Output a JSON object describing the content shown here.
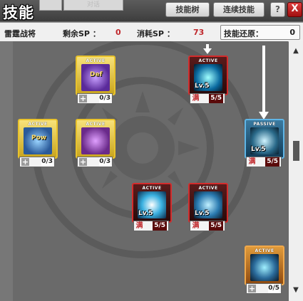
{
  "window": {
    "title": "技能",
    "ghost_tab_1": "",
    "ghost_tab_2": "对话",
    "tab_skill_tree": "技能树",
    "tab_combo_skill": "连续技能",
    "help": "?",
    "close": "X"
  },
  "info": {
    "class_name": "雷霆战将",
    "remaining_sp_label": "剩余SP ：",
    "remaining_sp": "0",
    "consumed_sp_label": "消耗SP ：",
    "consumed_sp": "73",
    "reset_label": "技能还原：",
    "reset_value": "0"
  },
  "colors": {
    "active_yellow": "#e8c22b",
    "active_red": "#d42c2c",
    "passive_blue": "#5fb5e6",
    "active_orange": "#f0a84a",
    "max_red": "#c0282c"
  },
  "skills": [
    {
      "id": "s1",
      "type": "ACTIVE",
      "state": "locked",
      "icon_text": "Def",
      "points": "0/3",
      "level": ""
    },
    {
      "id": "s2",
      "type": "ACTIVE",
      "state": "maxed",
      "icon_text": "",
      "points": "5/5",
      "level": "Lv.5",
      "max_mark": "满"
    },
    {
      "id": "s3",
      "type": "ACTIVE",
      "state": "locked",
      "icon_text": "Pow",
      "points": "0/3",
      "level": ""
    },
    {
      "id": "s4",
      "type": "ACTIVE",
      "state": "locked",
      "icon_text": "",
      "points": "0/3",
      "level": ""
    },
    {
      "id": "s5",
      "type": "PASSIVE",
      "state": "maxed",
      "icon_text": "",
      "points": "5/5",
      "level": "Lv.5",
      "max_mark": "满"
    },
    {
      "id": "s6",
      "type": "ACTIVE",
      "state": "maxed",
      "icon_text": "",
      "points": "5/5",
      "level": "Lv.5",
      "max_mark": "满"
    },
    {
      "id": "s7",
      "type": "ACTIVE",
      "state": "maxed",
      "icon_text": "",
      "points": "5/5",
      "level": "Lv.5",
      "max_mark": "满"
    },
    {
      "id": "s8",
      "type": "ACTIVE",
      "state": "locked",
      "icon_text": "",
      "points": "0/5",
      "level": ""
    }
  ],
  "scroll": {
    "up": "▲",
    "down": "▼"
  },
  "icons": {
    "plus": "+",
    "help": "question-icon",
    "close": "close-icon"
  }
}
